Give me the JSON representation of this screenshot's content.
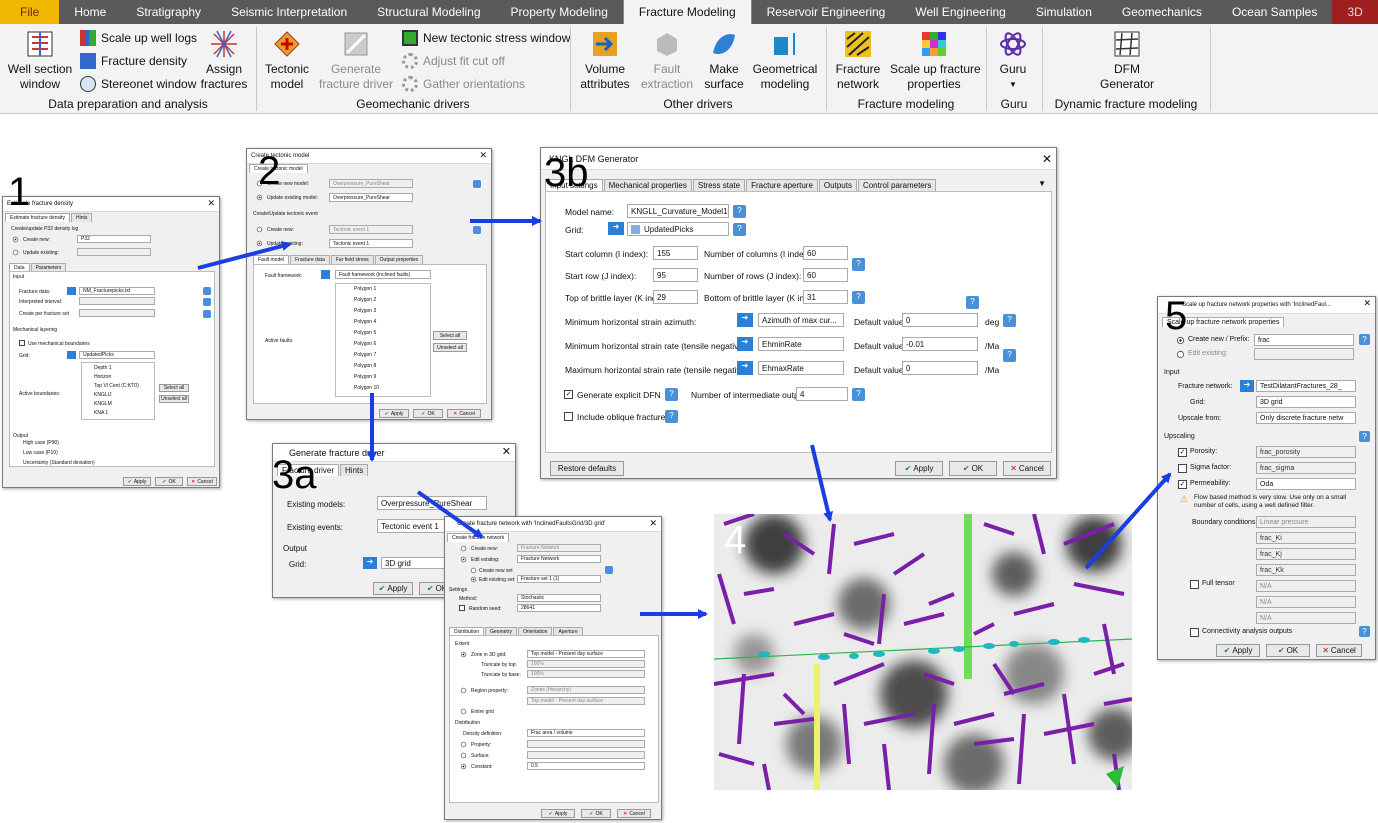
{
  "ribbon": {
    "tabs": [
      "File",
      "Home",
      "Stratigraphy",
      "Seismic Interpretation",
      "Structural Modeling",
      "Property Modeling",
      "Fracture Modeling",
      "Reservoir Engineering",
      "Well Engineering",
      "Simulation",
      "Geomechanics",
      "Ocean Samples",
      "3D"
    ],
    "active_tab": "Fracture Modeling",
    "buttons": {
      "well_section": "Well section\nwindow",
      "scale_up_well_logs": "Scale up well logs",
      "fracture_density": "Fracture density",
      "stereonet_window": "Stereonet window",
      "assign_fractures": "Assign\nfractures",
      "tectonic_model": "Tectonic\nmodel",
      "generate_fracture_driver": "Generate\nfracture driver",
      "new_tectonic_stress_window": "New tectonic stress window",
      "adjust_fit_cut_off": "Adjust fit cut off",
      "gather_orientations": "Gather orientations",
      "volume_attributes": "Volume\nattributes",
      "fault_extraction": "Fault\nextraction",
      "make_surface": "Make\nsurface",
      "geometrical_modeling": "Geometrical\nmodeling",
      "fracture_network": "Fracture\nnetwork",
      "scale_up_fracture_properties": "Scale up fracture\nproperties",
      "guru": "Guru",
      "dfm_generator": "DFM\nGenerator"
    },
    "groups": [
      "Data preparation and analysis",
      "Geomechanic drivers",
      "Other drivers",
      "Fracture modeling",
      "Guru",
      "Dynamic fracture modeling"
    ]
  },
  "labels": [
    "1",
    "2",
    "3a",
    "3b",
    "4",
    "5"
  ],
  "win1": {
    "title": "Estimate fracture density",
    "tabs": [
      "Estimate fracture density",
      "Hints"
    ],
    "create_label": "Create/update P32 density log",
    "create_new": "Create new:",
    "create_new_value": "P32",
    "update_existing": "Update existing:",
    "subtabs": [
      "Data",
      "Parameters"
    ],
    "input": "Input",
    "fracture_data": "Fracture data:",
    "fracture_data_value": "NM_Fracturepicks.txt",
    "interpreted_interval": "Interpreted interval:",
    "create_per_fracture_set": "Create per fracture set",
    "mech_layering": "Mechanical layering",
    "use_mech": "Use mechanical boundaries",
    "grid": "Grid:",
    "grid_value": "UpdatedPicks",
    "active_boundaries": "Active boundaries:",
    "boundaries": [
      "Depth 1",
      "Horizon",
      "Top Vl Cent (C:KT0)",
      "KNGLIJ",
      "KNGLM",
      "KNA 1"
    ],
    "select_all": "Select all",
    "unselect_all": "Unselect all",
    "output": "Output",
    "outputs": [
      "High case (P90)",
      "Low case (P10)",
      "Uncertainty (Standard deviation)"
    ],
    "apply": "Apply",
    "ok": "OK",
    "cancel": "Cancel"
  },
  "win2": {
    "title": "Create tectonic model",
    "tab": "Create tectonic model",
    "create_new_model": "Create new model:",
    "create_new_model_value": "Overpressure_PureShear",
    "update_existing_model": "Update existing model:",
    "update_existing_model_value": "Overpressure_PureShear",
    "event_header": "Create/Update tectonic event",
    "create_new": "Create new:",
    "create_new_value": "Tectonic event 1",
    "update_existing": "Update existing:",
    "update_existing_value": "Tectonic event 1",
    "subtabs": [
      "Fault model",
      "Fracture data",
      "Far field stress",
      "Output properties"
    ],
    "fault_framework": "Fault framework:",
    "fault_framework_value": "Fault framework (Inclined faults)",
    "active_faults": "Active faults:",
    "polygons": [
      "Polygon 1",
      "Polygon 2",
      "Polygon 3",
      "Polygon 4",
      "Polygon 5",
      "Polygon 6",
      "Polygon 7",
      "Polygon 8",
      "Polygon 9",
      "Polygon 10"
    ],
    "select_all": "Select all",
    "unselect_all": "Unselect all",
    "apply": "Apply",
    "ok": "OK",
    "cancel": "Cancel"
  },
  "win3a": {
    "title": "Generate fracture driver",
    "tabs": [
      "Fracture driver",
      "Hints"
    ],
    "existing_models": "Existing models:",
    "existing_models_value": "Overpressure_PureShear",
    "existing_events": "Existing events:",
    "existing_events_value": "Tectonic event 1",
    "output": "Output",
    "grid": "Grid:",
    "grid_value": "3D grid",
    "apply": "Apply",
    "ok": "OK"
  },
  "win3c": {
    "title": "Create fracture network with 'InclinedFaultsGrid/3D grid'",
    "tab": "Create fracture network",
    "create_new": "Create new:",
    "create_new_value": "Fracture Network",
    "edit_existing": "Edit existing:",
    "edit_existing_value": "Fracture Network",
    "create_new_set": "Create new set",
    "edit_existing_set": "Edit existing set:",
    "edit_existing_set_value": "Fracture set 1 (1)",
    "settings": "Settings",
    "method": "Method:",
    "method_value": "Stochastic",
    "random_seed": "Random seed:",
    "random_seed_value": "28641",
    "subtabs": [
      "Distribution",
      "Geometry",
      "Orientation",
      "Aperture"
    ],
    "extent": "Extent",
    "zone_3d": "Zone in 3D grid:",
    "zone_3d_value": "Top model - Present day surface",
    "truncate_top": "Truncate by top:",
    "truncate_base": "Truncate by base:",
    "pct": "100%",
    "region_property": "Region property:",
    "region_value": "Zones (Hierarchy)",
    "region_value2": "Top model - Present day surface",
    "entire_grid": "Entire grid",
    "distribution": "Distribution",
    "density_def": "Density definition:",
    "density_def_value": "Frac area / volume",
    "property": "Property:",
    "surface": "Surface:",
    "constant": "Constant:",
    "constant_value": "0.5",
    "apply": "Apply",
    "ok": "OK",
    "cancel": "Cancel"
  },
  "win3b": {
    "title": "KNGL DFM Generator",
    "tabs": [
      "Input settings",
      "Mechanical properties",
      "Stress state",
      "Fracture aperture",
      "Outputs",
      "Control parameters"
    ],
    "model_name": "Model name:",
    "model_name_value": "KNGLL_Curvature_Model1",
    "grid": "Grid:",
    "grid_value": "UpdatedPicks",
    "start_col": "Start column (I index):",
    "start_col_value": "155",
    "num_cols": "Number of columns (I index):",
    "num_cols_value": "60",
    "start_row": "Start row (J index):",
    "start_row_value": "95",
    "num_rows": "Number of rows (J index):",
    "num_rows_value": "60",
    "top_layer": "Top of brittle layer (K index):",
    "top_layer_value": "29",
    "bottom_layer": "Bottom of brittle layer (K index):",
    "bottom_layer_value": "31",
    "min_azimuth": "Minimum horizontal strain azimuth:",
    "min_azimuth_prop": "Azimuth of max cur...",
    "default_value": "Default value:",
    "az_default": "0",
    "deg": "deg",
    "min_rate": "Minimum horizontal strain rate (tensile negative):",
    "min_rate_prop": "EhminRate",
    "min_rate_default": "-0.01",
    "ma": "/Ma",
    "max_rate": "Maximum horizontal strain rate (tensile negative):",
    "max_rate_prop": "EhmaxRate",
    "max_rate_default": "0",
    "gen_dfn": "Generate explicit DFN",
    "num_outputs": "Number of intermediate outputs:",
    "num_outputs_value": "4",
    "include_oblique": "Include oblique fractures",
    "restore_defaults": "Restore defaults",
    "apply": "Apply",
    "ok": "OK",
    "cancel": "Cancel"
  },
  "win5": {
    "title": "Scale up fracture network properties with 'InclinedFaul...",
    "tab": "Scale up fracture network properties",
    "create_new": "Create new / Prefix:",
    "create_new_value": "frac",
    "edit_existing": "Edit existing:",
    "input": "Input",
    "fracture_network": "Fracture network:",
    "fracture_network_value": "TestDilatantFractures_28_",
    "grid": "Grid:",
    "grid_value": "3D grid",
    "upscale_from": "Upscale from:",
    "upscale_from_value": "Only discrete fracture netw",
    "upscaling": "Upscaling",
    "porosity": "Porosity:",
    "porosity_value": "frac_porosity",
    "sigma": "Sigma factor:",
    "sigma_value": "frac_sigma",
    "permeability": "Permeability:",
    "permeability_value": "Oda",
    "warning": "Flow based method is very slow. Use only on a small number of cells, using a well defined filter.",
    "boundary": "Boundary conditions:",
    "boundary_value": "Linear pressure",
    "ki": "frac_Ki",
    "kj": "frac_Kj",
    "kk": "frac_Kk",
    "full_tensor": "Full tensor",
    "na": "N/A",
    "connectivity": "Connectivity analysis outputs",
    "apply": "Apply",
    "ok": "OK",
    "cancel": "Cancel"
  },
  "colors": {
    "file_tab": "#f1b800",
    "tab_bar": "#5a5a5a",
    "arrow": "#1a3fe0",
    "fracture": "#7a1fa8"
  }
}
